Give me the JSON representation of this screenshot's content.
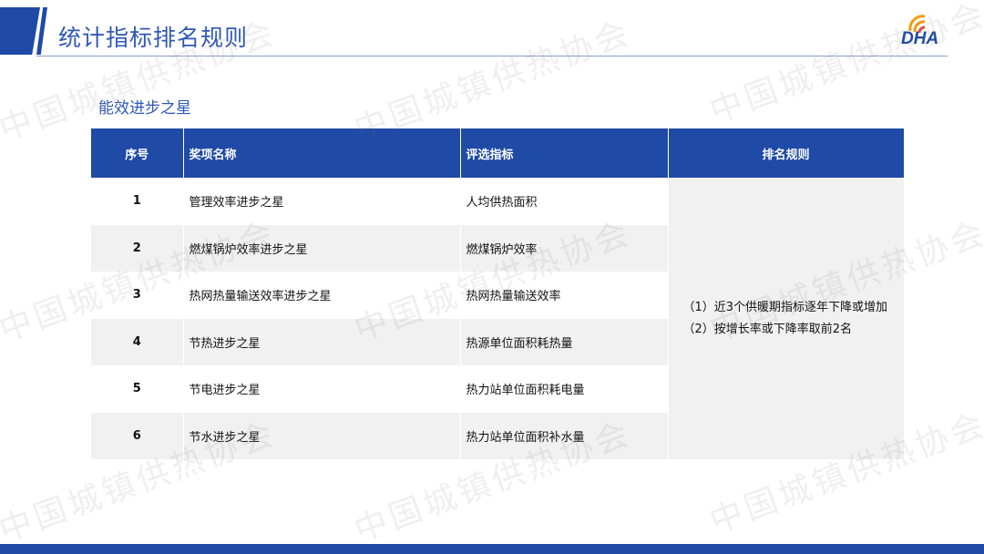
{
  "header": {
    "title": "统计指标排名规则"
  },
  "logo": {
    "text": "DHA"
  },
  "subtitle": "能效进步之星",
  "table": {
    "headers": [
      "序号",
      "奖项名称",
      "评选指标",
      "排名规则"
    ],
    "rows": [
      {
        "seq": "1",
        "award": "管理效率进步之星",
        "indicator": "人均供热面积"
      },
      {
        "seq": "2",
        "award": "燃煤锅炉效率进步之星",
        "indicator": "燃煤锅炉效率"
      },
      {
        "seq": "3",
        "award": "热网热量输送效率进步之星",
        "indicator": "热网热量输送效率"
      },
      {
        "seq": "4",
        "award": "节热进步之星",
        "indicator": "热源单位面积耗热量"
      },
      {
        "seq": "5",
        "award": "节电进步之星",
        "indicator": "热力站单位面积耗电量"
      },
      {
        "seq": "6",
        "award": "节水进步之星",
        "indicator": "热力站单位面积补水量"
      }
    ],
    "rule_lines": [
      "（1）近3个供暖期指标逐年下降或增加",
      "（2）按增长率或下降率取前2名"
    ]
  },
  "watermark": "中国城镇供热协会",
  "colors": {
    "primary": "#1f4aa5",
    "title": "#2f58b6",
    "stripe": "#f1f1f1"
  }
}
